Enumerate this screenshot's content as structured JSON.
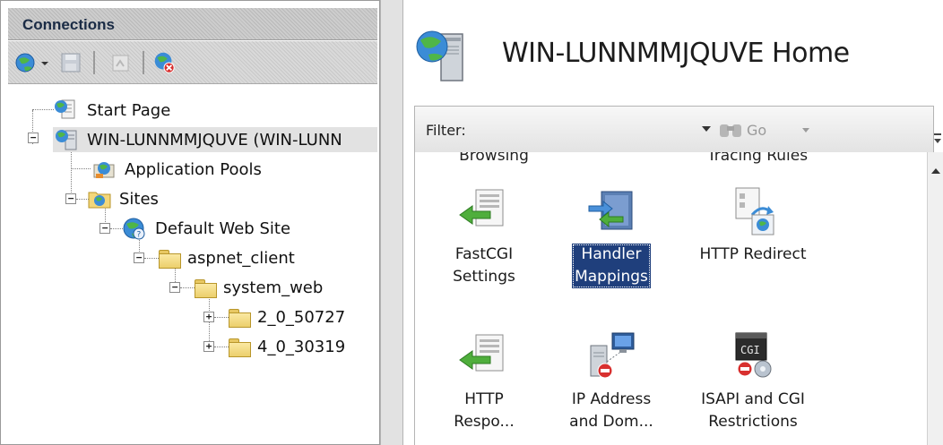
{
  "connections": {
    "title": "Connections",
    "toolbar": [
      {
        "icon": "globe-connect-icon",
        "has_dropdown": true
      },
      {
        "icon": "save-icon"
      },
      {
        "icon": "up-level-icon"
      },
      {
        "icon": "disconnect-icon"
      }
    ],
    "tree": [
      {
        "label": "Start Page",
        "icon": "start-page-icon"
      },
      {
        "label": "WIN-LUNNMMJQUVE (WIN-LUNN",
        "icon": "server-icon",
        "selected": true,
        "expander": "−"
      },
      {
        "label": "Application Pools",
        "icon": "app-pools-icon"
      },
      {
        "label": "Sites",
        "icon": "sites-folder-icon",
        "expander": "−"
      },
      {
        "label": "Default Web Site",
        "icon": "website-globe-icon",
        "expander": "−"
      },
      {
        "label": "aspnet_client",
        "icon": "folder-icon",
        "expander": "−"
      },
      {
        "label": "system_web",
        "icon": "folder-icon",
        "expander": "−"
      },
      {
        "label": "2_0_50727",
        "icon": "folder-icon",
        "expander": "+"
      },
      {
        "label": "4_0_30319",
        "icon": "folder-icon",
        "expander": "+"
      }
    ]
  },
  "main": {
    "title": "WIN-LUNNMMJQUVE Home",
    "filter": {
      "label": "Filter:",
      "value": "",
      "go_label": "Go"
    },
    "cutoff_labels": [
      "Browsing",
      "Tracing Rules"
    ],
    "features": [
      {
        "label_lines": [
          "FastCGI",
          "Settings"
        ],
        "icon": "fastcgi-settings-icon"
      },
      {
        "label_lines": [
          "Handler",
          "Mappings"
        ],
        "icon": "handler-mappings-icon",
        "selected": true
      },
      {
        "label_lines": [
          "HTTP Redirect",
          ""
        ],
        "icon": "http-redirect-icon"
      },
      {
        "label_lines": [
          "HTTP",
          "Respo..."
        ],
        "icon": "http-response-icon"
      },
      {
        "label_lines": [
          "IP Address",
          "and Dom..."
        ],
        "icon": "ip-address-icon"
      },
      {
        "label_lines": [
          "ISAPI and CGI",
          "Restrictions"
        ],
        "icon": "isapi-cgi-icon"
      }
    ]
  },
  "colors": {
    "selection": "#1f3f7c",
    "header_text": "#1a2b45",
    "tree_selection": "#e2e2e2"
  }
}
